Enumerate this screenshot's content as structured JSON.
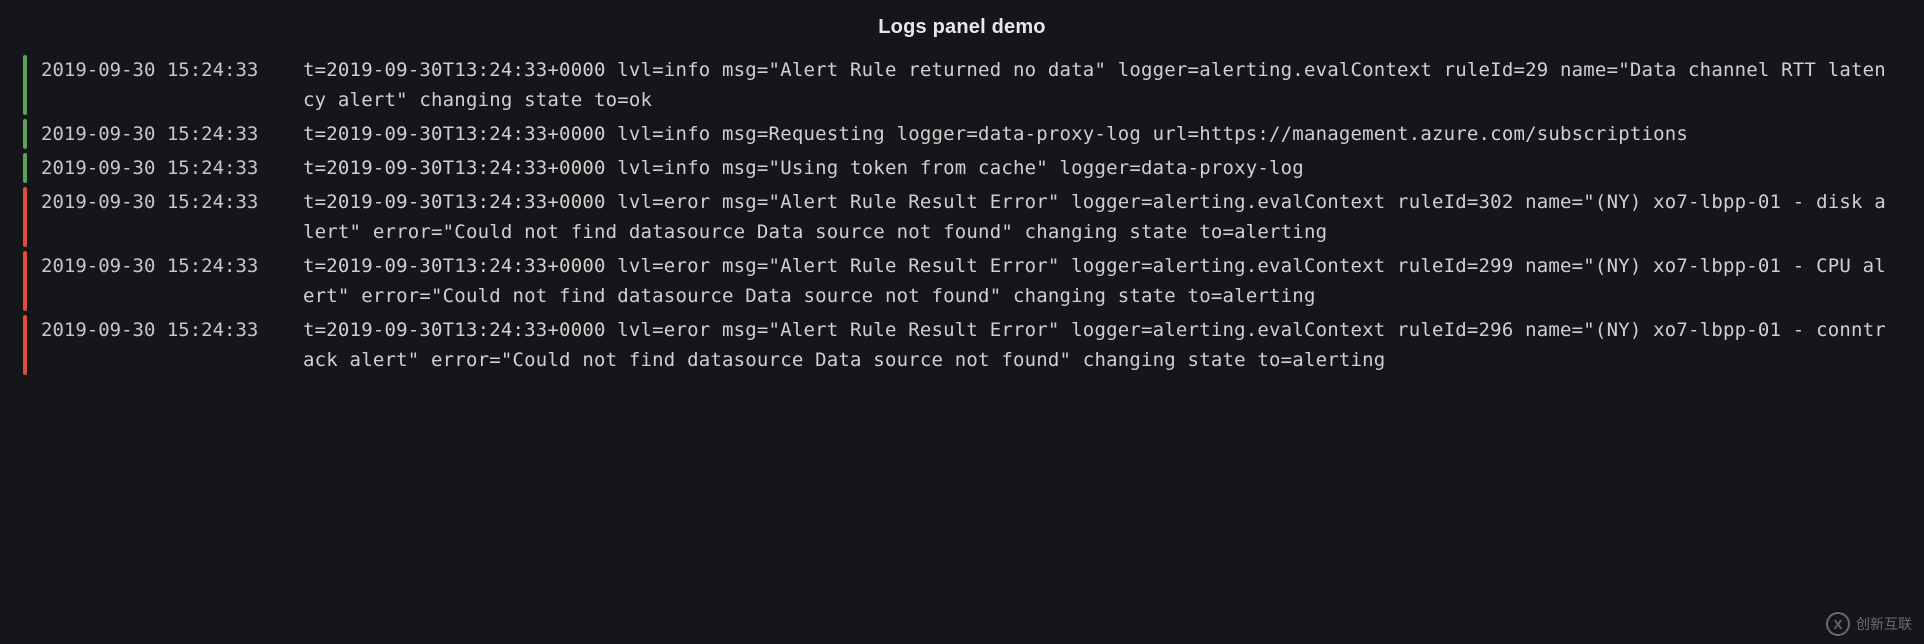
{
  "panel": {
    "title": "Logs panel demo"
  },
  "colors": {
    "info": "#5aa15a",
    "error": "#e24d42",
    "bg": "#141619"
  },
  "logs": [
    {
      "level": "info",
      "timestamp": "2019-09-30 15:24:33",
      "message": "t=2019-09-30T13:24:33+0000 lvl=info msg=\"Alert Rule returned no data\" logger=alerting.evalContext ruleId=29 name=\"Data channel RTT latency alert\" changing state to=ok"
    },
    {
      "level": "info",
      "timestamp": "2019-09-30 15:24:33",
      "message": "t=2019-09-30T13:24:33+0000 lvl=info msg=Requesting logger=data-proxy-log url=https://management.azure.com/subscriptions"
    },
    {
      "level": "info",
      "timestamp": "2019-09-30 15:24:33",
      "message": "t=2019-09-30T13:24:33+0000 lvl=info msg=\"Using token from cache\" logger=data-proxy-log"
    },
    {
      "level": "error",
      "timestamp": "2019-09-30 15:24:33",
      "message": "t=2019-09-30T13:24:33+0000 lvl=eror msg=\"Alert Rule Result Error\" logger=alerting.evalContext ruleId=302 name=\"(NY) xo7-lbpp-01 - disk alert\" error=\"Could not find datasource Data source not found\" changing state to=alerting"
    },
    {
      "level": "error",
      "timestamp": "2019-09-30 15:24:33",
      "message": "t=2019-09-30T13:24:33+0000 lvl=eror msg=\"Alert Rule Result Error\" logger=alerting.evalContext ruleId=299 name=\"(NY) xo7-lbpp-01 - CPU alert\" error=\"Could not find datasource Data source not found\" changing state to=alerting"
    },
    {
      "level": "error",
      "timestamp": "2019-09-30 15:24:33",
      "message": "t=2019-09-30T13:24:33+0000 lvl=eror msg=\"Alert Rule Result Error\" logger=alerting.evalContext ruleId=296 name=\"(NY) xo7-lbpp-01 - conntrack alert\" error=\"Could not find datasource Data source not found\" changing state to=alerting"
    }
  ],
  "watermark": {
    "text": "创新互联",
    "badge": "X"
  }
}
